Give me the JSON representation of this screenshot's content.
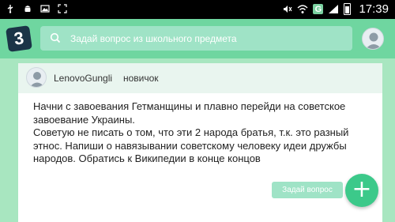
{
  "status_bar": {
    "time": "17:39",
    "notification_icons": [
      "usb-icon",
      "android-icon",
      "gallery-icon",
      "screenshot-icon"
    ],
    "system_icons": [
      "mute-icon",
      "wifi-icon",
      "google-icon",
      "signal-icon",
      "battery-icon"
    ]
  },
  "app_bar": {
    "logo_text": "3",
    "search_placeholder": "Задай вопрос из школьного предмета"
  },
  "answer": {
    "username": "LenovoGungli",
    "rank": "новичок",
    "paragraph_1": "Начни с завоевания Гетманщины и плавно перейди на советское завоевание Украины.",
    "paragraph_2": "Советую не писать о том, что эти 2 народа братья, т.к. это разный этнос. Напиши о навязывании советскому человеку идеи дружбы народов. Обратись к Википедии в конце концов"
  },
  "actions": {
    "ask_button_label": "Задай вопрос",
    "fab_symbol": "+"
  },
  "colors": {
    "page_background": "#a8e6c0",
    "app_bar": "#6fd6a0",
    "logo_background": "#1b3447",
    "fab": "#3cc98a"
  }
}
